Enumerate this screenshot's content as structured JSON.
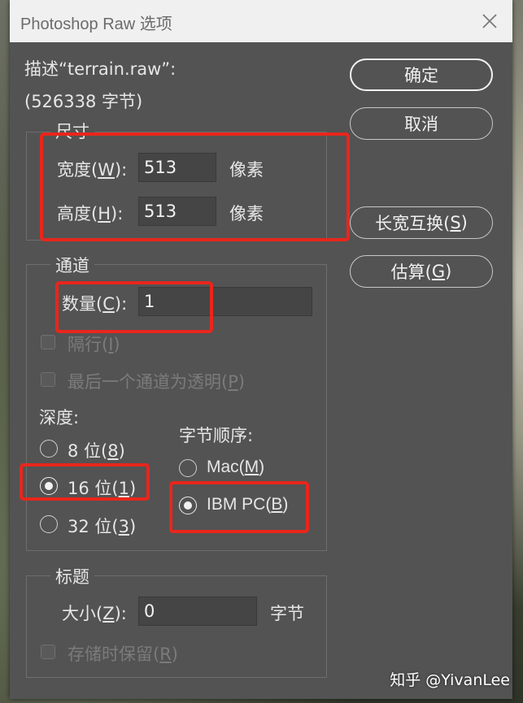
{
  "window": {
    "title": "Photoshop Raw 选项"
  },
  "description": {
    "line1": "描述“terrain.raw”:",
    "line2": "(526338 字节)"
  },
  "buttons": {
    "ok": "确定",
    "cancel": "取消",
    "swap_label": "长宽互换(",
    "swap_key": "S",
    "estimate_label": "估算(",
    "estimate_key": "G",
    "close_paren": ")"
  },
  "dimensions": {
    "group_label": "尺寸",
    "width_label": "宽度(",
    "width_key": "W",
    "width_suffix": "):",
    "width_value": "513",
    "height_label": "高度(",
    "height_key": "H",
    "height_suffix": "):",
    "height_value": "513",
    "unit": "像素"
  },
  "channels": {
    "group_label": "通道",
    "count_label": "数量(",
    "count_key": "C",
    "count_suffix": "):",
    "count_value": "1",
    "interleaved_label": "隔行(",
    "interleaved_key": "I",
    "interleaved_suffix": ")",
    "transparent_label": "最后一个通道为透明(",
    "transparent_key": "P",
    "transparent_suffix": ")",
    "depth_label": "深度:",
    "depth_8_label": "8 位(",
    "depth_8_key": "8",
    "depth_16_label": "16 位(",
    "depth_16_key": "1",
    "depth_32_label": "32 位(",
    "depth_32_key": "3",
    "depth_selected": "16",
    "byte_order_label": "字节顺序:",
    "mac_label": "Mac(",
    "mac_key": "M",
    "ibm_label": "IBM PC(",
    "ibm_key": "B",
    "byte_order_selected": "IBM PC"
  },
  "header": {
    "group_label": "标题",
    "size_label": "大小(",
    "size_key": "Z",
    "size_suffix": "):",
    "size_value": "0",
    "size_unit": "字节",
    "retain_label": "存储时保留(",
    "retain_key": "R",
    "retain_suffix": ")"
  },
  "watermark": "知乎 @YivanLee",
  "colors": {
    "dialog_bg": "#535353",
    "highlight": "#e8261c",
    "field_bg": "#454545"
  }
}
